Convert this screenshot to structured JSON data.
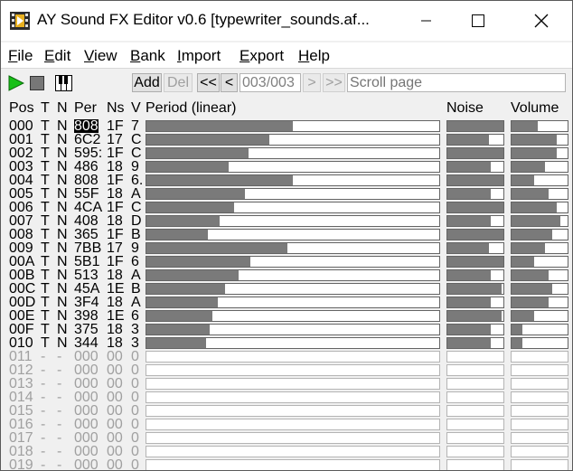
{
  "window": {
    "title": "AY Sound FX Editor v0.6 [typewriter_sounds.af..."
  },
  "menu": [
    "File",
    "Edit",
    "View",
    "Bank",
    "Import",
    "Export",
    "Help"
  ],
  "toolbar": {
    "add_label": "Add",
    "del_label": "Del",
    "first_label": "<<",
    "prev_label": "<",
    "page_value": "003/003",
    "next_label": ">",
    "last_label": ">>",
    "scroll_placeholder": "Scroll page"
  },
  "headers": {
    "pos": "Pos",
    "t": "T",
    "n": "N",
    "per": "Per",
    "ns": "Ns",
    "v": "V",
    "period": "Period (linear)",
    "noise": "Noise",
    "volume": "Volume"
  },
  "rows": [
    {
      "pos": "000",
      "t": "T",
      "n": "N",
      "per": "808",
      "ns": "1F",
      "v": "7",
      "period": 0.5,
      "noise": 1.0,
      "volume": 0.467,
      "selected": true
    },
    {
      "pos": "001",
      "t": "T",
      "n": "N",
      "per": "6C2",
      "ns": "17",
      "v": "C",
      "period": 0.42,
      "noise": 0.742,
      "volume": 0.8
    },
    {
      "pos": "002",
      "t": "T",
      "n": "N",
      "per": "595:",
      "ns": "1F",
      "v": "C",
      "period": 0.35,
      "noise": 1.0,
      "volume": 0.8
    },
    {
      "pos": "003",
      "t": "T",
      "n": "N",
      "per": "486",
      "ns": "18",
      "v": "9",
      "period": 0.28,
      "noise": 0.774,
      "volume": 0.6
    },
    {
      "pos": "004",
      "t": "T",
      "n": "N",
      "per": "808",
      "ns": "1F",
      "v": "6.",
      "period": 0.5,
      "noise": 1.0,
      "volume": 0.4
    },
    {
      "pos": "005",
      "t": "T",
      "n": "N",
      "per": "55F",
      "ns": "18",
      "v": "A",
      "period": 0.335,
      "noise": 0.774,
      "volume": 0.667
    },
    {
      "pos": "006",
      "t": "T",
      "n": "N",
      "per": "4CA",
      "ns": "1F",
      "v": "C",
      "period": 0.3,
      "noise": 1.0,
      "volume": 0.8
    },
    {
      "pos": "007",
      "t": "T",
      "n": "N",
      "per": "408",
      "ns": "18",
      "v": "D",
      "period": 0.25,
      "noise": 0.774,
      "volume": 0.867
    },
    {
      "pos": "008",
      "t": "T",
      "n": "N",
      "per": "365",
      "ns": "1F",
      "v": "B",
      "period": 0.21,
      "noise": 1.0,
      "volume": 0.733
    },
    {
      "pos": "009",
      "t": "T",
      "n": "N",
      "per": "7BB",
      "ns": "17",
      "v": "9",
      "period": 0.48,
      "noise": 0.742,
      "volume": 0.6
    },
    {
      "pos": "00A",
      "t": "T",
      "n": "N",
      "per": "5B1",
      "ns": "1F",
      "v": "6",
      "period": 0.355,
      "noise": 1.0,
      "volume": 0.4
    },
    {
      "pos": "00B",
      "t": "T",
      "n": "N",
      "per": "513",
      "ns": "18",
      "v": "A",
      "period": 0.315,
      "noise": 0.774,
      "volume": 0.667
    },
    {
      "pos": "00C",
      "t": "T",
      "n": "N",
      "per": "45A",
      "ns": "1E",
      "v": "B",
      "period": 0.27,
      "noise": 0.968,
      "volume": 0.733
    },
    {
      "pos": "00D",
      "t": "T",
      "n": "N",
      "per": "3F4",
      "ns": "18",
      "v": "A",
      "period": 0.245,
      "noise": 0.774,
      "volume": 0.667
    },
    {
      "pos": "00E",
      "t": "T",
      "n": "N",
      "per": "398",
      "ns": "1E",
      "v": "6",
      "period": 0.225,
      "noise": 0.968,
      "volume": 0.4
    },
    {
      "pos": "00F",
      "t": "T",
      "n": "N",
      "per": "375",
      "ns": "18",
      "v": "3",
      "period": 0.215,
      "noise": 0.774,
      "volume": 0.2
    },
    {
      "pos": "010",
      "t": "T",
      "n": "N",
      "per": "344",
      "ns": "18",
      "v": "3",
      "period": 0.205,
      "noise": 0.774,
      "volume": 0.2
    },
    {
      "pos": "011",
      "t": "-",
      "n": "-",
      "per": "000",
      "ns": "00",
      "v": "0",
      "period": 0,
      "noise": 0,
      "volume": 0,
      "empty": true
    },
    {
      "pos": "012",
      "t": "-",
      "n": "-",
      "per": "000",
      "ns": "00",
      "v": "0",
      "period": 0,
      "noise": 0,
      "volume": 0,
      "empty": true
    },
    {
      "pos": "013",
      "t": "-",
      "n": "-",
      "per": "000",
      "ns": "00",
      "v": "0",
      "period": 0,
      "noise": 0,
      "volume": 0,
      "empty": true
    },
    {
      "pos": "014",
      "t": "-",
      "n": "-",
      "per": "000",
      "ns": "00",
      "v": "0",
      "period": 0,
      "noise": 0,
      "volume": 0,
      "empty": true
    },
    {
      "pos": "015",
      "t": "-",
      "n": "-",
      "per": "000",
      "ns": "00",
      "v": "0",
      "period": 0,
      "noise": 0,
      "volume": 0,
      "empty": true
    },
    {
      "pos": "016",
      "t": "-",
      "n": "-",
      "per": "000",
      "ns": "00",
      "v": "0",
      "period": 0,
      "noise": 0,
      "volume": 0,
      "empty": true
    },
    {
      "pos": "017",
      "t": "-",
      "n": "-",
      "per": "000",
      "ns": "00",
      "v": "0",
      "period": 0,
      "noise": 0,
      "volume": 0,
      "empty": true
    },
    {
      "pos": "018",
      "t": "-",
      "n": "-",
      "per": "000",
      "ns": "00",
      "v": "0",
      "period": 0,
      "noise": 0,
      "volume": 0,
      "empty": true
    },
    {
      "pos": "019",
      "t": "-",
      "n": "-",
      "per": "000",
      "ns": "00",
      "v": "0",
      "period": 0,
      "noise": 0,
      "volume": 0,
      "empty": true
    }
  ],
  "colors": {
    "bar_fill": "#7a7a7a",
    "play_green": "#18c018",
    "selection": "#000000"
  }
}
